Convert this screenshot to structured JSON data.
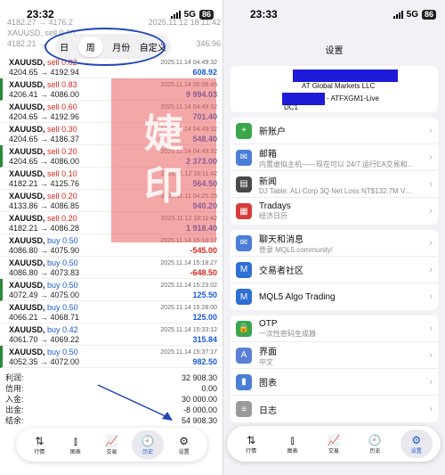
{
  "left": {
    "time": "23:32",
    "network": "5G",
    "battery": "86",
    "segments": [
      "日",
      "周",
      "月份",
      "自定义"
    ],
    "active_segment": "周",
    "ghost_rows": [
      {
        "left": "4182.27 → 4176.2",
        "right": "2025.11.12 18:11:42"
      },
      {
        "left": "XAUUSD, sell 0.20",
        "right": ""
      },
      {
        "left": "4182.21 →",
        "right": "346.96"
      }
    ],
    "trades": [
      {
        "sym": "XAUUSD,",
        "side": "sell",
        "vol": "0.02",
        "date": "2025.11.14 04:49:32",
        "prices": "4204.65 → 4192.94",
        "profit": "608.92",
        "marked": false
      },
      {
        "sym": "XAUUSD,",
        "side": "sell",
        "vol": "0.83",
        "date": "2025.11.14 05:08:46",
        "prices": "4206.41 → 4086.00",
        "profit": "9 994.03",
        "marked": true
      },
      {
        "sym": "XAUUSD,",
        "side": "sell",
        "vol": "0.60",
        "date": "2025.11.14 04:49:32",
        "prices": "4204.65 → 4192.96",
        "profit": "701.40",
        "marked": false
      },
      {
        "sym": "XAUUSD,",
        "side": "sell",
        "vol": "0.30",
        "date": "2025.11.14 04:49:32",
        "prices": "4204.65 → 4186.37",
        "profit": "548.40",
        "marked": false
      },
      {
        "sym": "XAUUSD,",
        "side": "sell",
        "vol": "0.20",
        "date": "2025.11.14 04:49:32",
        "prices": "4204.65 → 4086.00",
        "profit": "2 373.00",
        "marked": true
      },
      {
        "sym": "XAUUSD,",
        "side": "sell",
        "vol": "0.10",
        "date": "2025.11.12 18:11:42",
        "prices": "4182.21 → 4125.76",
        "profit": "564.50",
        "marked": false
      },
      {
        "sym": "XAUUSD,",
        "side": "sell",
        "vol": "0.20",
        "date": "2025.11.11 04:25:26",
        "prices": "4133.86 → 4086.85",
        "profit": "940.20",
        "marked": false
      },
      {
        "sym": "XAUUSD,",
        "side": "sell",
        "vol": "0.20",
        "date": "2025.11.12 18:11:42",
        "prices": "4182.21 → 4086.28",
        "profit": "1 918.40",
        "marked": false
      },
      {
        "sym": "XAUUSD,",
        "side": "buy",
        "vol": "0.50",
        "date": "2025.11.14 15:18:17",
        "prices": "4086.80 → 4075.90",
        "profit": "-545.00",
        "marked": false
      },
      {
        "sym": "XAUUSD,",
        "side": "buy",
        "vol": "0.50",
        "date": "2025.11.14 15:18:27",
        "prices": "4086.80 → 4073.83",
        "profit": "-648.50",
        "marked": false
      },
      {
        "sym": "XAUUSD,",
        "side": "buy",
        "vol": "0.50",
        "date": "2025.11.14 15:23:02",
        "prices": "4072.49 → 4075.00",
        "profit": "125.50",
        "marked": true
      },
      {
        "sym": "XAUUSD,",
        "side": "buy",
        "vol": "0.50",
        "date": "2025.11.14 15:28:00",
        "prices": "4066.21 → 4068.71",
        "profit": "125.00",
        "marked": false
      },
      {
        "sym": "XAUUSD,",
        "side": "buy",
        "vol": "0.42",
        "date": "2025.11.14 15:33:12",
        "prices": "4061.70 → 4069.22",
        "profit": "315.84",
        "marked": false
      },
      {
        "sym": "XAUUSD,",
        "side": "buy",
        "vol": "0.50",
        "date": "2025.11.14 15:37:17",
        "prices": "4052.35 → 4072.00",
        "profit": "982.50",
        "marked": true
      }
    ],
    "summary": [
      {
        "label": "利润:",
        "value": "32 908.30"
      },
      {
        "label": "信用:",
        "value": "0.00"
      },
      {
        "label": "入金:",
        "value": "30 000.00"
      },
      {
        "label": "出金:",
        "value": "-8 000.00"
      },
      {
        "label": "结余:",
        "value": "54 908.30"
      }
    ],
    "tabs": [
      {
        "label": "行情",
        "icon": "⇅",
        "icon_name": "quotes-icon"
      },
      {
        "label": "图表",
        "icon": "⫾",
        "icon_name": "candlestick-icon"
      },
      {
        "label": "交易",
        "icon": "📈",
        "icon_name": "trade-chart-icon"
      },
      {
        "label": "历史",
        "icon": "🕘",
        "icon_name": "history-clock-icon"
      },
      {
        "label": "设置",
        "icon": "⚙",
        "icon_name": "gear-icon"
      }
    ],
    "active_tab": "历史"
  },
  "right": {
    "time": "23:33",
    "network": "5G",
    "battery": "86",
    "title": "设置",
    "account_name": "AT Global Markets LLC",
    "server": "- ATFXGM1-Live",
    "dc": "DC1",
    "groups": [
      [
        {
          "title": "新账户",
          "sub": "",
          "color": "#3aa64c",
          "icon": "+",
          "icon_name": "new-account-icon"
        },
        {
          "title": "邮箱",
          "sub": "内置虚拟主机——现在可以 24/7 运行EA交易和…",
          "color": "#4a7ed8",
          "icon": "✉",
          "icon_name": "mail-icon"
        },
        {
          "title": "新闻",
          "sub": "DJ Table: ALi Corp 3Q Net Loss NT$132.7M V…",
          "color": "#4a4a4a",
          "icon": "▤",
          "icon_name": "news-icon"
        },
        {
          "title": "Tradays",
          "sub": "经济日历",
          "color": "#d83a3a",
          "icon": "▦",
          "icon_name": "calendar-icon"
        }
      ],
      [
        {
          "title": "聊天和消息",
          "sub": "登录 MQL5.community!",
          "color": "#4a7ed8",
          "icon": "✉",
          "icon_name": "chat-icon"
        },
        {
          "title": "交易者社区",
          "sub": "",
          "color": "#2f6fd6",
          "icon": "M",
          "icon_name": "community-icon"
        },
        {
          "title": "MQL5 Algo Trading",
          "sub": "",
          "color": "#2f6fd6",
          "icon": "M",
          "icon_name": "mql5-icon"
        }
      ],
      [
        {
          "title": "OTP",
          "sub": "一次性密码生成器",
          "color": "#3aa64c",
          "icon": "🔒",
          "icon_name": "lock-icon"
        },
        {
          "title": "界面",
          "sub": "中文",
          "color": "#5b7fd6",
          "icon": "A",
          "icon_name": "language-icon"
        },
        {
          "title": "图表",
          "sub": "",
          "color": "#4a7ed8",
          "icon": "▮",
          "icon_name": "chart-icon"
        },
        {
          "title": "日志",
          "sub": "",
          "color": "#9a9a9a",
          "icon": "≡",
          "icon_name": "log-icon"
        }
      ]
    ],
    "tabs": [
      {
        "label": "行情",
        "icon": "⇅",
        "icon_name": "quotes-icon"
      },
      {
        "label": "图表",
        "icon": "⫾",
        "icon_name": "candlestick-icon"
      },
      {
        "label": "交易",
        "icon": "📈",
        "icon_name": "trade-chart-icon"
      },
      {
        "label": "历史",
        "icon": "🕘",
        "icon_name": "history-clock-icon"
      },
      {
        "label": "设置",
        "icon": "⚙",
        "icon_name": "gear-icon"
      }
    ],
    "active_tab": "设置"
  },
  "colors": {
    "sell": "#d9261c",
    "buy": "#1a5bd6",
    "annotation": "#2147b5",
    "watermark": "#eb5f5f"
  },
  "watermark": {
    "chars": [
      "婕",
      "印"
    ]
  }
}
